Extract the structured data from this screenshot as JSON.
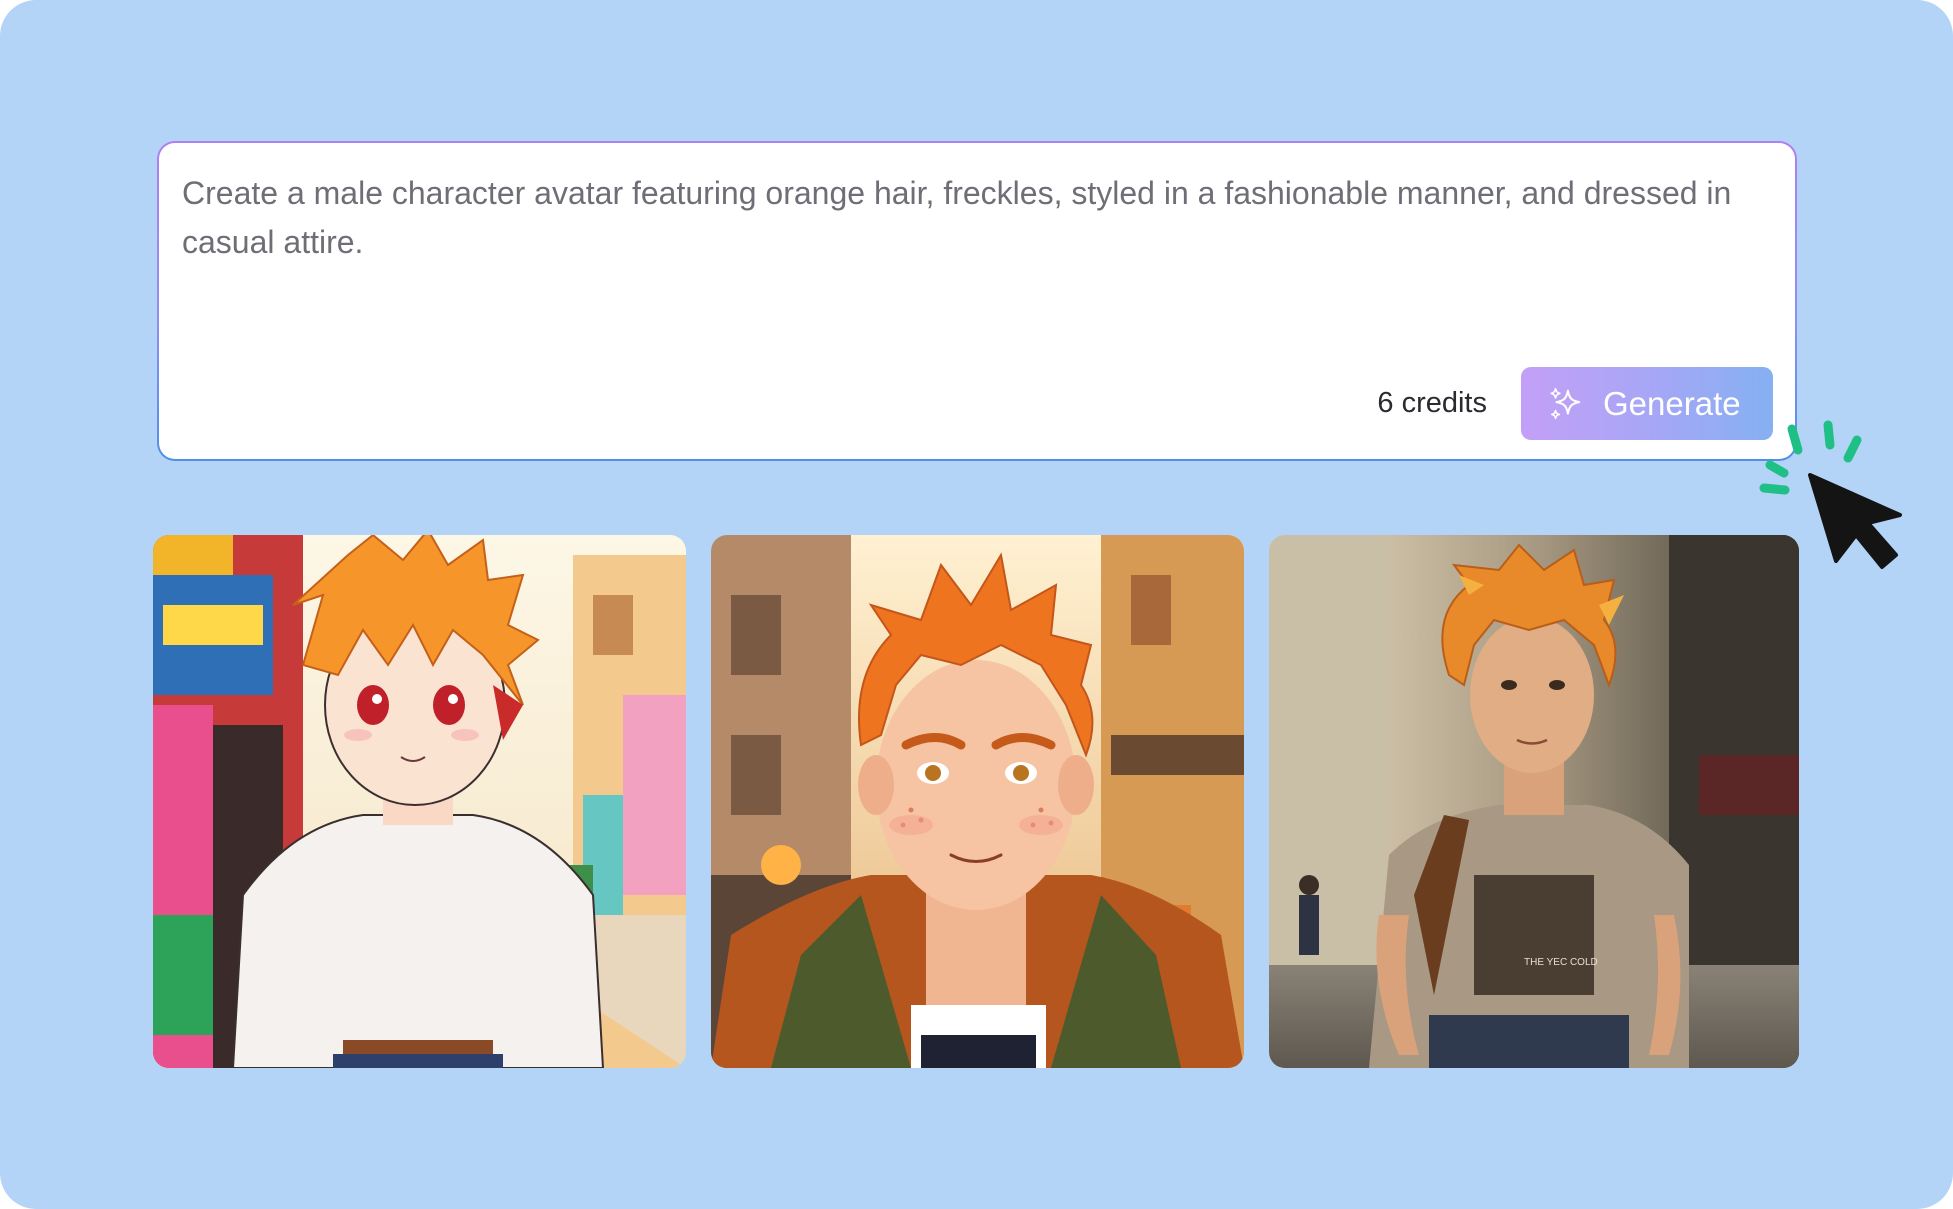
{
  "prompt": {
    "text": "Create a male character avatar featuring orange hair, freckles, styled in a fashionable manner, and dressed in casual attire."
  },
  "credits_label": "6 credits",
  "generate_button": {
    "label": "Generate",
    "icon": "sparkles-icon"
  },
  "cursor": {
    "icon": "mouse-pointer-click-icon"
  },
  "gallery": {
    "images": [
      {
        "name": "anime-avatar-image",
        "style": "anime"
      },
      {
        "name": "cartoon-avatar-image",
        "style": "illustrated"
      },
      {
        "name": "photo-avatar-image",
        "style": "photorealistic"
      }
    ]
  },
  "colors": {
    "background": "#b3d4f7",
    "accent_gradient_start": "#c3a0f7",
    "accent_gradient_end": "#85b0f2",
    "cursor_click_marks": "#1fbf86"
  }
}
